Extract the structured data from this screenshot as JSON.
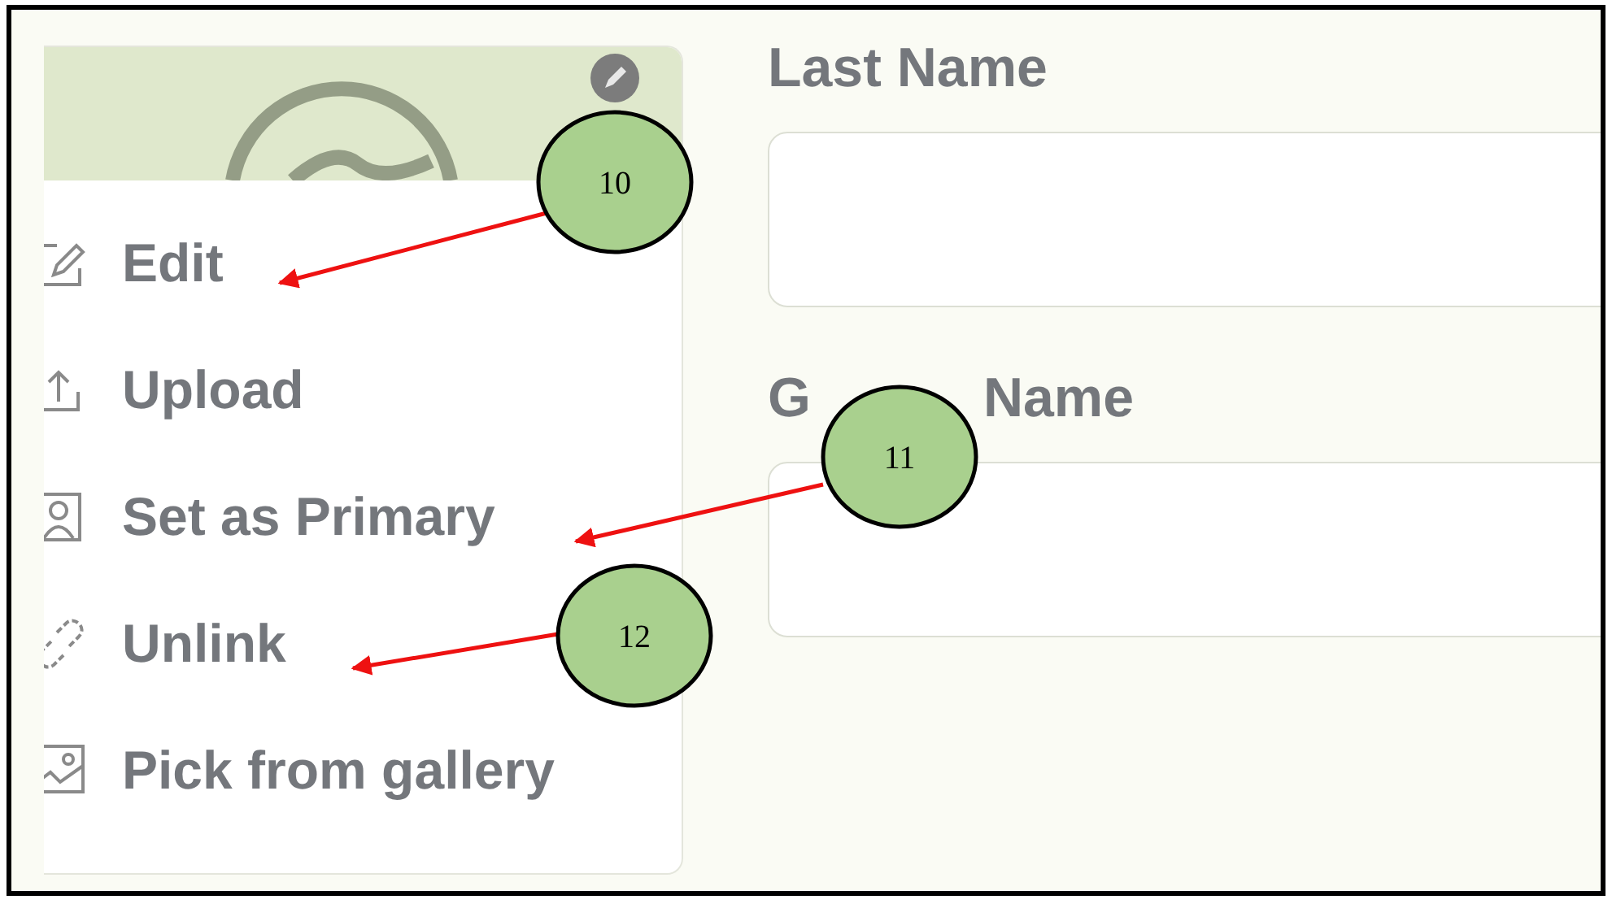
{
  "photo_menu": {
    "items": [
      {
        "label": "Edit"
      },
      {
        "label": "Upload"
      },
      {
        "label": "Set as Primary"
      },
      {
        "label": "Unlink"
      },
      {
        "label": "Pick from gallery"
      }
    ]
  },
  "fields": [
    {
      "label_parts": [
        "Last Name"
      ]
    },
    {
      "label_parts": [
        "G",
        "Name"
      ]
    }
  ],
  "callouts": [
    {
      "number": "10"
    },
    {
      "number": "11"
    },
    {
      "number": "12"
    }
  ]
}
